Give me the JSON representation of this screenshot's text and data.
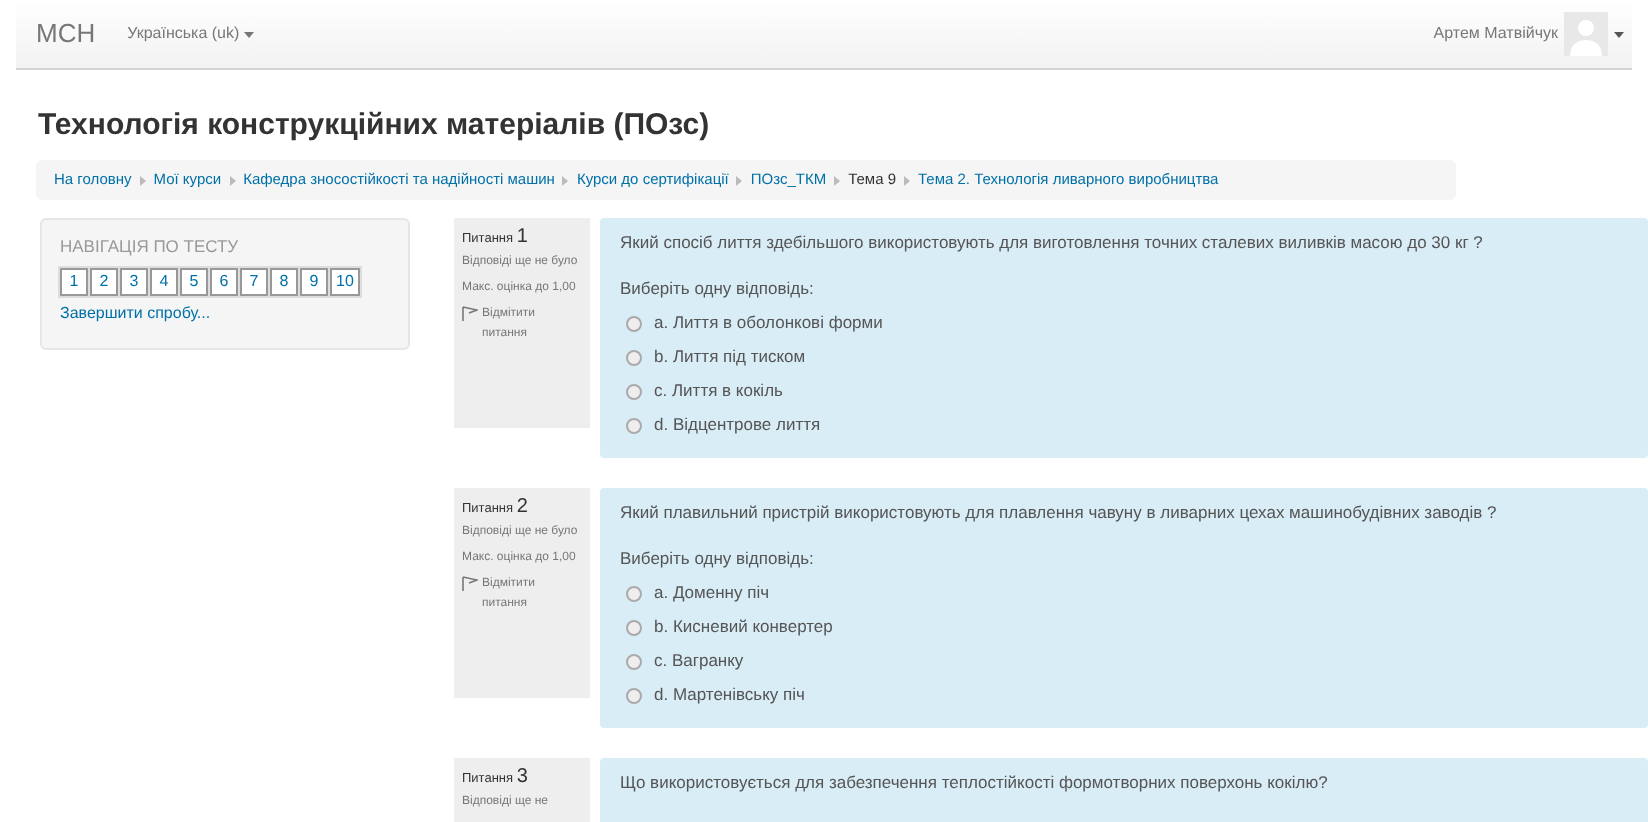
{
  "navbar": {
    "brand": "MCH",
    "language": "Українська (uk)",
    "user": "Артем Матвійчук"
  },
  "page_title": "Технологія конструкційних матеріалів (ПОзс)",
  "breadcrumbs": [
    {
      "label": "На головну",
      "link": true
    },
    {
      "label": "Мої курси",
      "link": true
    },
    {
      "label": "Кафедра зносостійкості та надійності машин",
      "link": true
    },
    {
      "label": "Курси до сертифікації",
      "link": true
    },
    {
      "label": "ПОзс_ТКМ",
      "link": true
    },
    {
      "label": "Тема 9",
      "link": false
    },
    {
      "label": "Тема 2. Технологія ливарного виробництва",
      "link": true
    }
  ],
  "quiz_navigation": {
    "title": "НАВІГАЦІЯ ПО ТЕСТУ",
    "buttons": [
      "1",
      "2",
      "3",
      "4",
      "5",
      "6",
      "7",
      "8",
      "9",
      "10"
    ],
    "finish_link": "Завершити спробу..."
  },
  "questions": [
    {
      "label": "Питання",
      "number": "1",
      "status": "Відповіді ще не було",
      "mark": "Макс. оцінка до 1,00",
      "flag": "Відмітити питання",
      "text": "Який спосіб лиття здебільшого використовують для виготовлення точних сталевих виливків масою до 30 кг ?",
      "prompt": "Виберіть одну відповідь:",
      "options": [
        {
          "letter": "a.",
          "text": "Лиття в оболонкові форми",
          "selected": false
        },
        {
          "letter": "b.",
          "text": "Лиття під тиском",
          "selected": false
        },
        {
          "letter": "c.",
          "text": "Лиття в кокіль",
          "selected": false
        },
        {
          "letter": "d.",
          "text": "Відцентрове лиття",
          "selected": false
        }
      ]
    },
    {
      "label": "Питання",
      "number": "2",
      "status": "Відповіді ще не було",
      "mark": "Макс. оцінка до 1,00",
      "flag": "Відмітити питання",
      "text": "Який плавильний пристрій використовують для плавлення чавуну в ливарних цехах машинобудівних заводів ?",
      "prompt": "Виберіть одну відповідь:",
      "options": [
        {
          "letter": "a.",
          "text": "Доменну піч",
          "selected": false
        },
        {
          "letter": "b.",
          "text": "Кисневий конвертер",
          "selected": false
        },
        {
          "letter": "c.",
          "text": "Вагранку",
          "selected": false
        },
        {
          "letter": "d.",
          "text": "Мартенівську піч",
          "selected": false
        }
      ]
    },
    {
      "label": "Питання",
      "number": "3",
      "status": "Відповіді ще не",
      "text": "Що використовується для забезпечення теплостійкості формотворних поверхонь кокілю?"
    }
  ]
}
